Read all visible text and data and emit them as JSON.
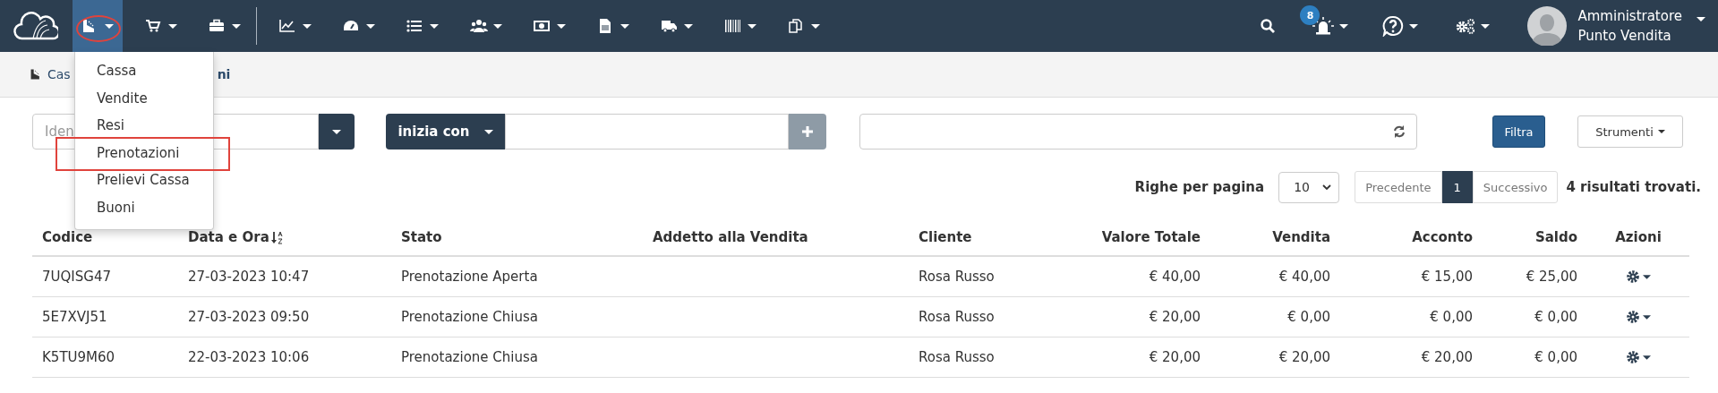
{
  "navbar": {
    "groups": [
      [
        {
          "selected": true,
          "marked": true
        },
        {
          "selected": false,
          "marked": false
        },
        {
          "selected": false,
          "marked": false
        }
      ],
      [
        {
          "selected": false,
          "marked": false
        },
        {
          "selected": false,
          "marked": false
        },
        {
          "selected": false,
          "marked": false
        },
        {
          "selected": false,
          "marked": false
        },
        {
          "selected": false,
          "marked": false
        },
        {
          "selected": false,
          "marked": false
        },
        {
          "selected": false,
          "marked": false
        },
        {
          "selected": false,
          "marked": false
        },
        {
          "selected": false,
          "marked": false
        }
      ]
    ],
    "alerts_badge": "8",
    "user": {
      "name": "Amministratore",
      "role": "Punto Vendita"
    }
  },
  "menu": {
    "items": [
      {
        "label": "Cassa",
        "marked": false
      },
      {
        "label": "Vendite",
        "marked": false
      },
      {
        "label": "Resi",
        "marked": false
      },
      {
        "label": "Prenotazioni",
        "marked": true
      },
      {
        "label": "Prelievi Cassa",
        "marked": false
      },
      {
        "label": "Buoni",
        "marked": false
      }
    ]
  },
  "breadcrumb": {
    "start": "Cas",
    "end": "ni"
  },
  "filters": {
    "field_placeholder": "Iden",
    "match_mode": "inizia con",
    "filter_button": "Filtra",
    "tools_button": "Strumenti"
  },
  "pagination": {
    "rows_label": "Righe per pagina",
    "rows_per_page": "10",
    "previous": {
      "label": "Precedente",
      "disabled": true
    },
    "pages": [
      {
        "label": "1",
        "selected": true
      }
    ],
    "next": {
      "label": "Successivo",
      "disabled": true
    },
    "results": "4 risultati trovati."
  },
  "table": {
    "columns": [
      {
        "label": "Codice",
        "sorted": false
      },
      {
        "label": "Data e Ora",
        "sorted": true
      },
      {
        "label": "Stato",
        "sorted": false
      },
      {
        "label": "Addetto alla Vendita",
        "sorted": false
      },
      {
        "label": "Cliente",
        "sorted": false
      },
      {
        "label": "Valore Totale",
        "sorted": false
      },
      {
        "label": "Vendita",
        "sorted": false
      },
      {
        "label": "Acconto",
        "sorted": false
      },
      {
        "label": "Saldo",
        "sorted": false
      },
      {
        "label": "Azioni",
        "sorted": false
      }
    ],
    "rows": [
      {
        "cells": [
          "7UQISG47",
          "27-03-2023 10:47",
          "Prenotazione Aperta",
          "",
          "Rosa Russo",
          "€ 40,00",
          "€ 40,00",
          "€ 15,00",
          "€ 25,00"
        ]
      },
      {
        "cells": [
          "5E7XVJ51",
          "27-03-2023 09:50",
          "Prenotazione Chiusa",
          "",
          "Rosa Russo",
          "€ 20,00",
          "€ 0,00",
          "€ 0,00",
          "€ 0,00"
        ]
      },
      {
        "cells": [
          "K5TU9M60",
          "22-03-2023 10:06",
          "Prenotazione Chiusa",
          "",
          "Rosa Russo",
          "€ 20,00",
          "€ 20,00",
          "€ 20,00",
          "€ 0,00"
        ]
      }
    ]
  }
}
